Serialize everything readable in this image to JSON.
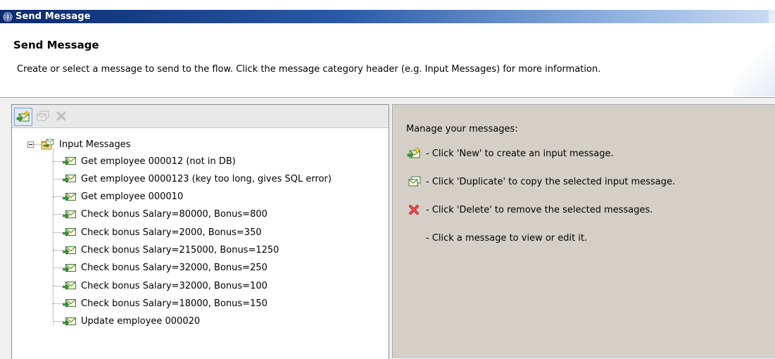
{
  "window": {
    "title": "Send Message",
    "icon": "globe-icon"
  },
  "header": {
    "title": "Send Message",
    "description": "Create or select a message to send to the flow. Click the message category header (e.g. Input Messages) for more information."
  },
  "toolbar": {
    "new_icon": "new-message-icon",
    "duplicate_icon": "duplicate-message-icon",
    "delete_icon": "delete-icon"
  },
  "tree": {
    "root_label": "Input Messages",
    "items": [
      {
        "label": "Get employee 000012 (not in DB)"
      },
      {
        "label": "Get employee 0000123 (key too long, gives SQL error)"
      },
      {
        "label": "Get employee 000010"
      },
      {
        "label": "Check bonus Salary=80000, Bonus=800"
      },
      {
        "label": "Check bonus Salary=2000, Bonus=350"
      },
      {
        "label": "Check bonus Salary=215000, Bonus=1250"
      },
      {
        "label": "Check bonus Salary=32000, Bonus=250"
      },
      {
        "label": "Check bonus Salary=32000, Bonus=100"
      },
      {
        "label": "Check bonus Salary=18000, Bonus=150"
      },
      {
        "label": "Update employee 000020"
      }
    ]
  },
  "help": {
    "title": "Manage your messages:",
    "new": "- Click 'New' to create an input message.",
    "duplicate": "- Click 'Duplicate' to copy the selected input message.",
    "delete": "- Click 'Delete' to remove the selected messages.",
    "view": "- Click a message to view or edit it."
  },
  "colors": {
    "titlebar_start": "#0b2a70",
    "titlebar_end": "#c9daf2",
    "panel_background": "#d4d0c8",
    "delete_red": "#d9262e",
    "envelope_green": "#3c9a3c"
  }
}
